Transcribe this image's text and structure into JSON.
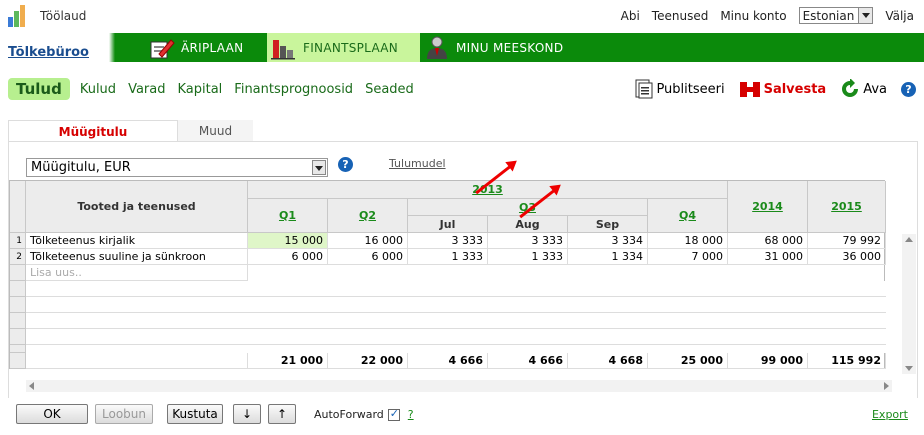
{
  "topbar": {
    "title": "Töölaud",
    "links": [
      "Abi",
      "Teenused",
      "Minu konto"
    ],
    "language": "Estonian",
    "logout": "Välja"
  },
  "nav": {
    "company": "Tõlkebüroo",
    "items": [
      {
        "label": "ÄRIPLAAN",
        "icon": "pencil-plan-icon",
        "active": false
      },
      {
        "label": "FINANTSPLAAN",
        "icon": "bar-chart-icon",
        "active": true
      },
      {
        "label": "MINU MEESKOND",
        "icon": "person-icon",
        "active": false
      }
    ]
  },
  "subnav": {
    "items": [
      "Tulud",
      "Kulud",
      "Varad",
      "Kapital",
      "Finantsprognoosid",
      "Seaded"
    ],
    "active_index": 0
  },
  "actions": {
    "publish": "Publitseeri",
    "save": "Salvesta",
    "open": "Ava",
    "help": "?"
  },
  "tabs": [
    "Müügitulu",
    "Muud"
  ],
  "panel": {
    "combo_value": "Müügitulu, EUR",
    "help": "?",
    "model_link": "Tulumudel"
  },
  "grid": {
    "col_label": "Tooted ja teenused",
    "year_2013": "2013",
    "q1": "Q1",
    "q2": "Q2",
    "q3": "Q3",
    "q4": "Q4",
    "jul": "Jul",
    "aug": "Aug",
    "sep": "Sep",
    "y2014": "2014",
    "y2015": "2015",
    "rows": [
      {
        "num": "1",
        "name": "Tõlketeenus kirjalik",
        "values": [
          "15 000",
          "16 000",
          "3 333",
          "3 333",
          "3 334",
          "18 000",
          "68 000",
          "79 992"
        ]
      },
      {
        "num": "2",
        "name": "Tõlketeenus suuline ja sünkroon",
        "values": [
          "6 000",
          "6 000",
          "1 333",
          "1 333",
          "1 334",
          "7 000",
          "31 000",
          "36 000"
        ]
      }
    ],
    "placeholder": "Lisa uus..",
    "totals": [
      "21 000",
      "22 000",
      "4 666",
      "4 666",
      "4 668",
      "25 000",
      "99 000",
      "115 992"
    ]
  },
  "footer": {
    "ok": "OK",
    "cancel": "Loobun",
    "delete": "Kustuta",
    "down": "↓",
    "up": "↑",
    "autoforward": "AutoForward",
    "help": "?",
    "export": "Export"
  },
  "colors": {
    "nav_green": "#0b8a0b",
    "active_tab_green": "#c9f59c",
    "link_green": "#1a8a1a",
    "accent_red": "#d60000",
    "help_blue": "#1762b5"
  }
}
